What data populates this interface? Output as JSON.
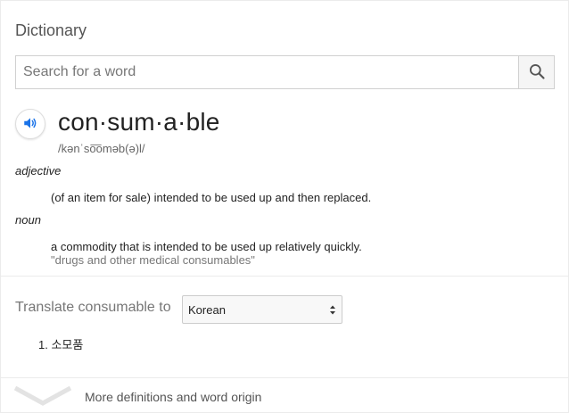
{
  "header": {
    "title": "Dictionary"
  },
  "search": {
    "placeholder": "Search for a word",
    "value": "",
    "button_icon": "search-icon"
  },
  "entry": {
    "speaker_icon": "speaker-icon",
    "headword": "con·sum·a·ble",
    "phonetic": "/kənˈso͞oməb(ə)l/",
    "senses": [
      {
        "part_of_speech": "adjective",
        "definition": "(of an item for sale) intended to be used up and then replaced.",
        "example": ""
      },
      {
        "part_of_speech": "noun",
        "definition": "a commodity that is intended to be used up relatively quickly.",
        "example": "\"drugs and other medical consumables\""
      }
    ]
  },
  "translate": {
    "label": "Translate consumable to",
    "selected_language": "Korean",
    "results": [
      "1. 소모품"
    ]
  },
  "footer": {
    "more_label": "More definitions and word origin",
    "chevron_icon": "chevron-down-icon"
  },
  "colors": {
    "accent_blue": "#1a73e8",
    "muted_text": "#777777",
    "divider": "#ebebeb"
  }
}
